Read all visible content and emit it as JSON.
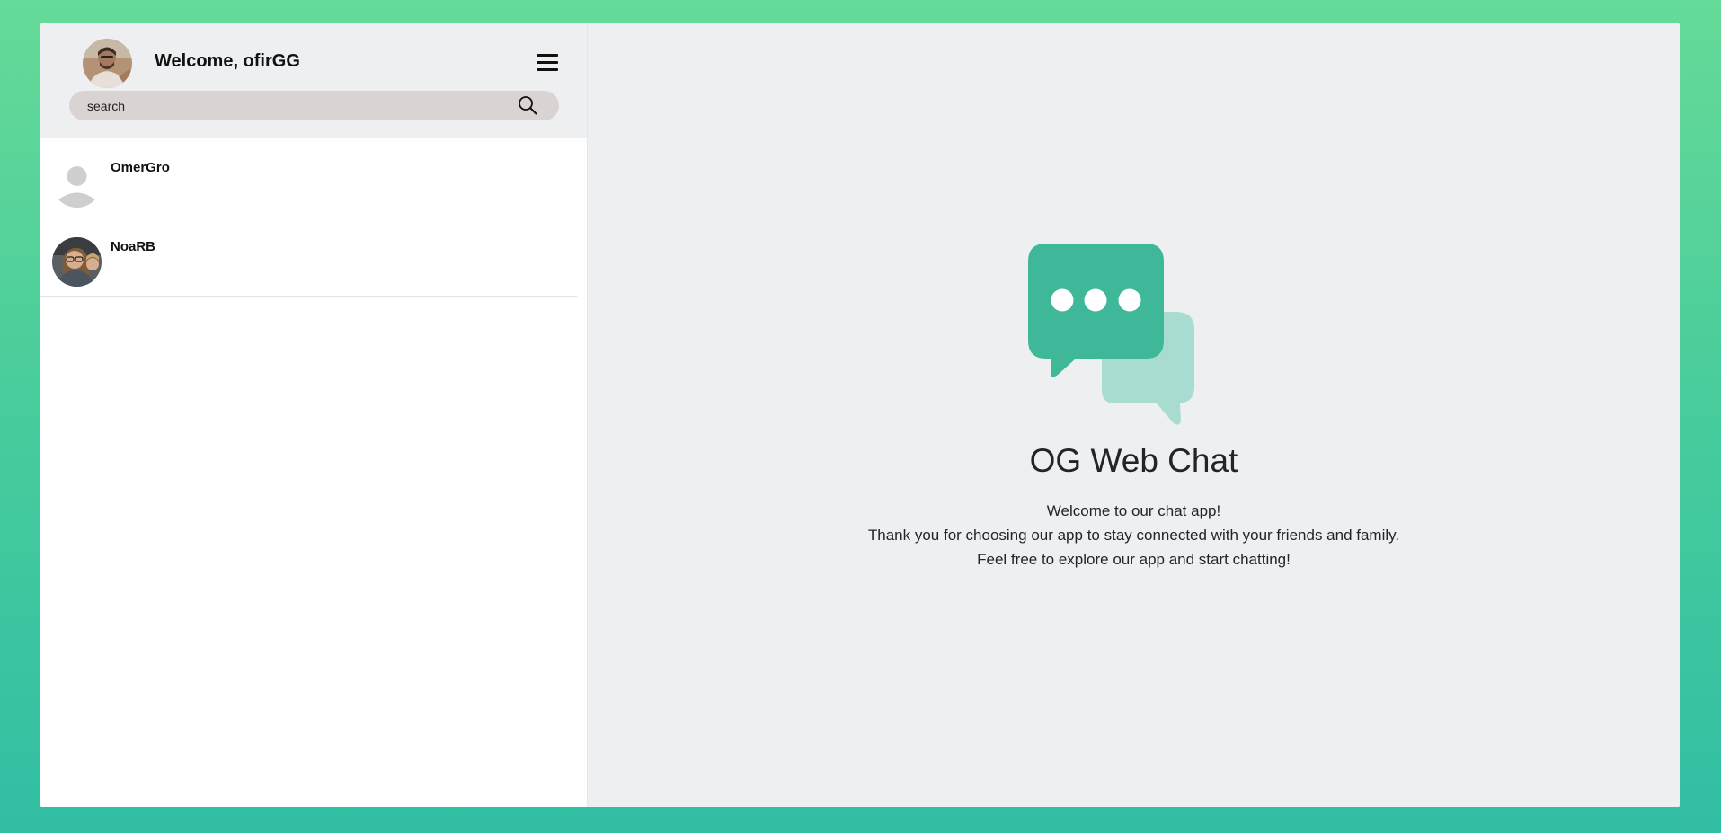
{
  "header": {
    "welcome": "Welcome, ofirGG"
  },
  "search": {
    "placeholder": "search",
    "value": ""
  },
  "contacts": [
    {
      "name": "OmerGro"
    },
    {
      "name": "NoaRB"
    }
  ],
  "main": {
    "title": "OG Web Chat",
    "lines": [
      "Welcome to our chat app!",
      "Thank you for choosing our app to stay connected with your friends and family.",
      "Feel free to explore our app and start chatting!"
    ]
  },
  "colors": {
    "accent": "#3eb898",
    "accent_light": "#a8dcd0",
    "search_bg": "#d9d3d3",
    "panel_bg": "#eeeff1"
  },
  "icons": {
    "menu": "hamburger-icon",
    "search": "search-icon",
    "logo": "chat-bubbles-icon"
  }
}
